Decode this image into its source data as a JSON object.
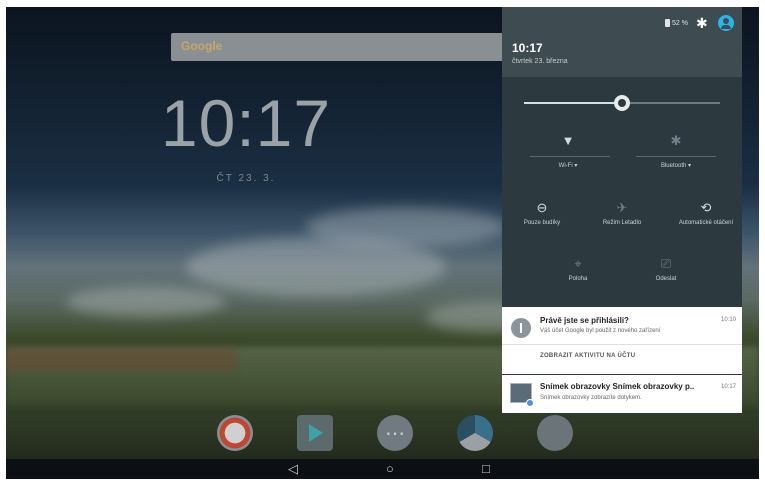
{
  "home": {
    "search_logo": "Google",
    "clock": "10:17",
    "date": "ČT 23. 3."
  },
  "dock": {
    "apps": [
      "google-app-icon",
      "play-store-icon",
      "app-drawer-icon",
      "chrome-icon",
      "camera-icon"
    ]
  },
  "navbar": {
    "back": "◁",
    "home": "○",
    "recents": "□"
  },
  "shade": {
    "battery": "52 %",
    "time": "10:17",
    "date": "čtvrtek 23. března",
    "brightness_level": 0.5,
    "tiles": {
      "wifi": "Wi-Fi",
      "bluetooth": "Bluetooth",
      "dnd": "Pouze budíky",
      "airplane": "Režim Letadlo",
      "rotation": "Automatické otáčení",
      "location": "Poloha",
      "cast": "Odeslat"
    }
  },
  "notifications": [
    {
      "title": "Právě jste se přihlásili?",
      "text": "Váš účet Google byl použit z nového zařízení",
      "time": "10:10",
      "action": "ZOBRAZIT AKTIVITU NA ÚČTU"
    },
    {
      "title": "Snímek obrazovky Snímek obrazovky p..",
      "text": "Snímek obrazovky zobrazíte dotykem.",
      "time": "10:17"
    }
  ],
  "colors": {
    "shade_bg": "#2c3a40",
    "shade_header": "#3e4b51",
    "accent_avatar": "#26b6ec"
  }
}
